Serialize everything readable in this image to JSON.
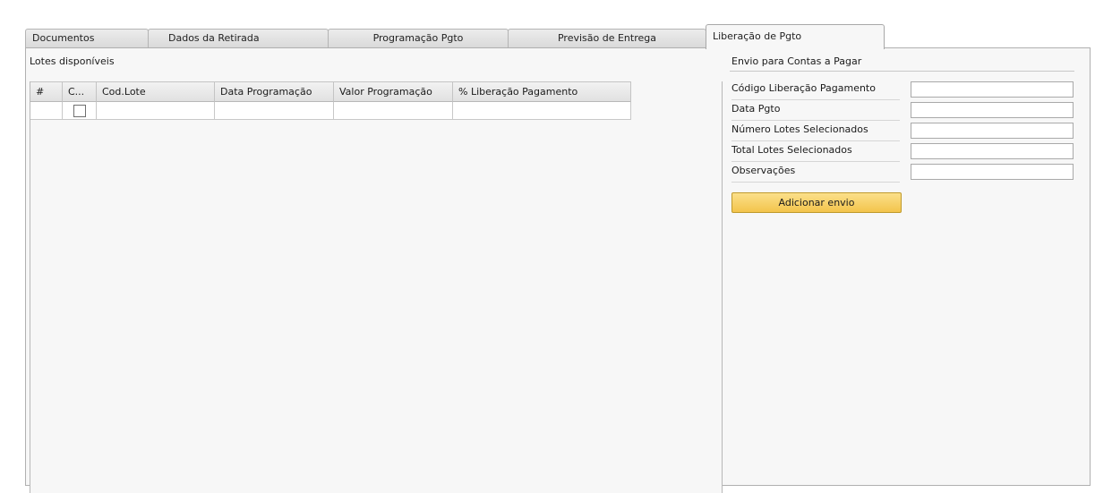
{
  "tabs": [
    {
      "label": "Documentos",
      "active": false
    },
    {
      "label": "Dados da Retirada",
      "active": false
    },
    {
      "label": "Programação Pgto",
      "active": false
    },
    {
      "label": "Previsão de Entrega",
      "active": false
    },
    {
      "label": "Liberação de Pgto",
      "active": true
    }
  ],
  "left_section": {
    "title": "Lotes disponíveis",
    "grid": {
      "columns": [
        "#",
        "C...",
        "Cod.Lote",
        "Data Programação",
        "Valor Programação",
        "% Liberação Pagamento"
      ],
      "rows": [
        {
          "num": "",
          "checked": false,
          "cod_lote": "",
          "data_programacao": "",
          "valor_programacao": "",
          "perc_liberacao": ""
        }
      ]
    }
  },
  "right_section": {
    "title": "Envio para Contas a Pagar",
    "fields": [
      {
        "label": "Código Liberação Pagamento",
        "value": ""
      },
      {
        "label": "Data Pgto",
        "value": ""
      },
      {
        "label": "Número Lotes Selecionados",
        "value": ""
      },
      {
        "label": "Total Lotes Selecionados",
        "value": ""
      },
      {
        "label": "Observações",
        "value": ""
      }
    ],
    "button_label": "Adicionar envio"
  },
  "colors": {
    "panel_bg": "#f7f7f7",
    "button_bg": "#f3c44b",
    "border": "#b0b0b0"
  }
}
